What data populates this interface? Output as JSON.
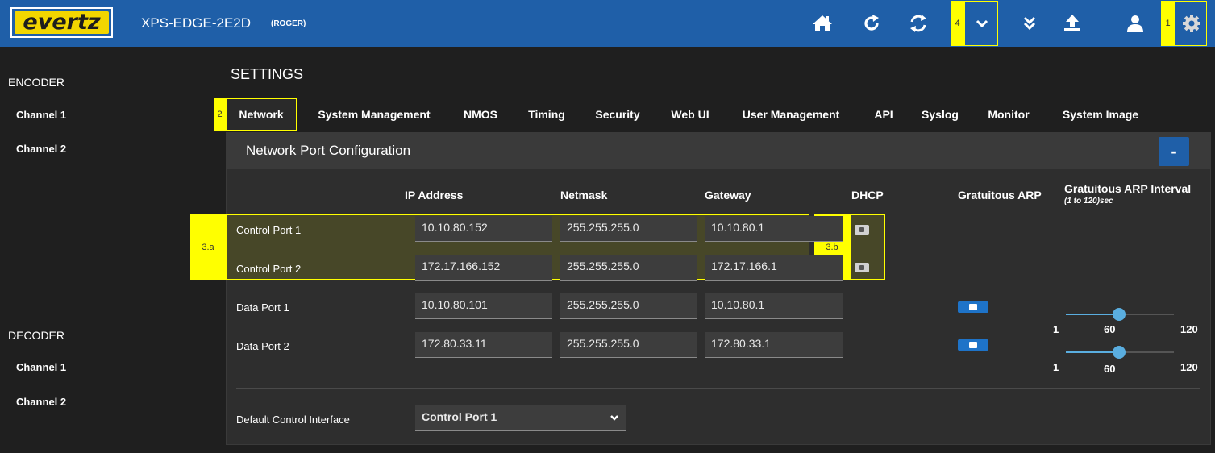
{
  "header": {
    "logo_text": "evertz",
    "device_name": "XPS-EDGE-2E2D",
    "device_sub": "(ROGER)",
    "icons": [
      "home-icon",
      "refresh-icon",
      "sync-icon",
      "chevron-down-icon",
      "double-chevron-down-icon",
      "upload-icon",
      "user-icon",
      "gear-icon"
    ]
  },
  "markers": {
    "m1": "1",
    "m2": "2",
    "m3a": "3.a",
    "m3b": "3.b",
    "m4": "4"
  },
  "sidebar": {
    "encoder": "ENCODER",
    "encoder_items": [
      "Channel 1",
      "Channel 2"
    ],
    "decoder": "DECODER",
    "decoder_items": [
      "Channel 1",
      "Channel 2"
    ]
  },
  "settings": {
    "title": "SETTINGS",
    "tabs": [
      "Network",
      "System Management",
      "NMOS",
      "Timing",
      "Security",
      "Web UI",
      "User Management",
      "API",
      "Syslog",
      "Monitor",
      "System Image"
    ],
    "active_tab": "Network"
  },
  "panel": {
    "title": "Network Port Configuration",
    "collapse_label": "-",
    "columns": {
      "ip": "IP Address",
      "netmask": "Netmask",
      "gateway": "Gateway",
      "dhcp": "DHCP",
      "garp": "Gratuitous ARP",
      "garp_interval": "Gratuitous ARP Interval",
      "garp_interval_sub": "(1 to 120)sec"
    },
    "rows": [
      {
        "label": "Control Port 1",
        "ip": "10.10.80.152",
        "netmask": "255.255.255.0",
        "gateway": "10.10.80.1",
        "dhcp": "off"
      },
      {
        "label": "Control Port 2",
        "ip": "172.17.166.152",
        "netmask": "255.255.255.0",
        "gateway": "172.17.166.1",
        "dhcp": "off"
      },
      {
        "label": "Data Port 1",
        "ip": "10.10.80.101",
        "netmask": "255.255.255.0",
        "gateway": "10.10.80.1",
        "garp": "on",
        "interval": {
          "min": "1",
          "value": "60",
          "max": "120"
        }
      },
      {
        "label": "Data Port 2",
        "ip": "172.80.33.11",
        "netmask": "255.255.255.0",
        "gateway": "172.80.33.1",
        "garp": "on",
        "interval": {
          "min": "1",
          "value": "60",
          "max": "120"
        }
      }
    ],
    "default_interface_label": "Default Control Interface",
    "default_interface_value": "Control Port 1"
  },
  "colors": {
    "header_bg": "#1f5fa8",
    "page_bg": "#1f1f1f",
    "panel_bg": "#2e2e2e",
    "accent": "#1e73c8",
    "marker": "#ffff00",
    "slider": "#5aaee0"
  }
}
